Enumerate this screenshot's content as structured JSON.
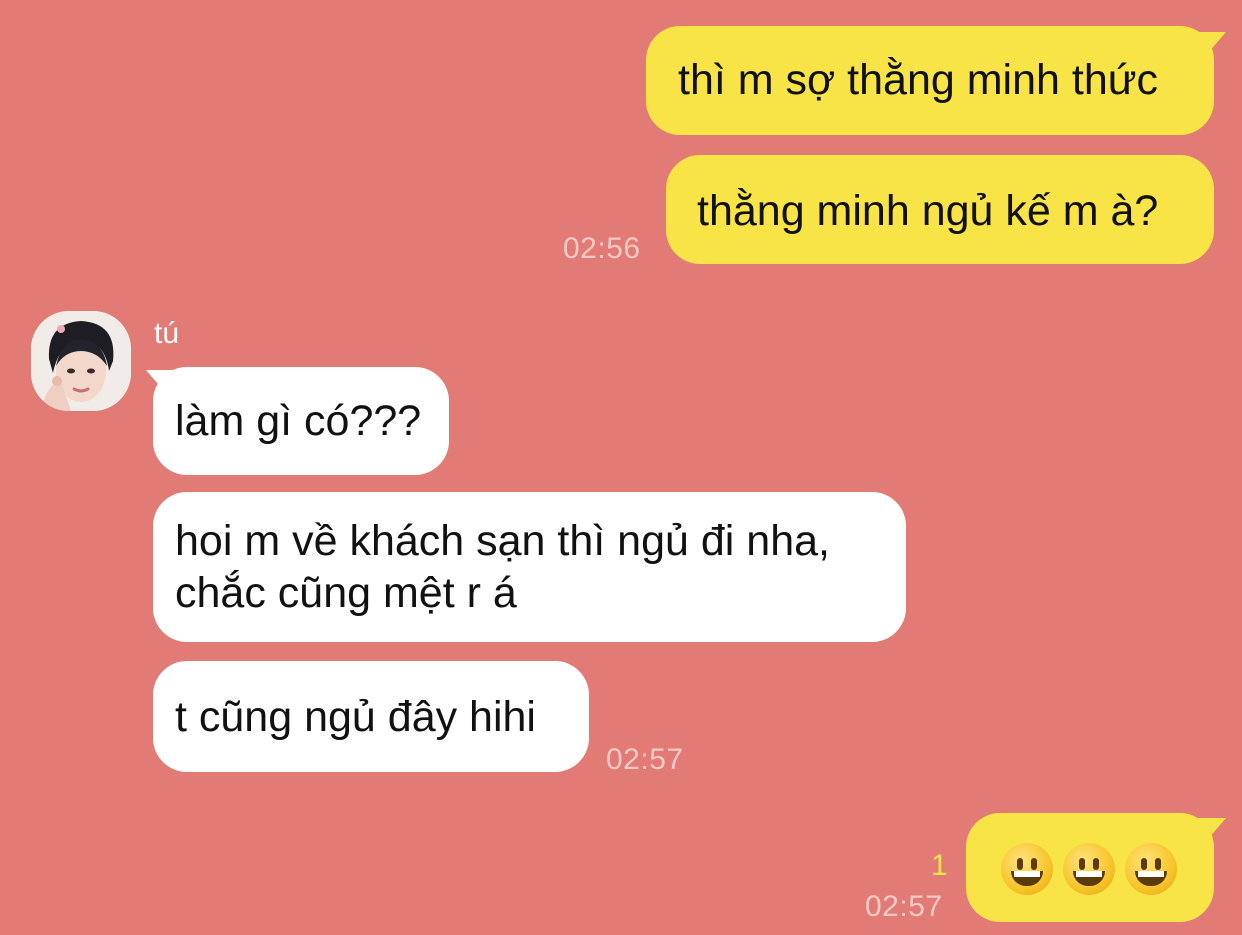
{
  "messages": {
    "out1": {
      "text": "thì m sợ thằng minh thức"
    },
    "out2": {
      "text": "thằng minh ngủ kế m à?",
      "time": "02:56"
    },
    "sender_name": "tú",
    "in1": {
      "text": "làm gì có???"
    },
    "in2": {
      "line1": "hoi m về khách sạn thì ngủ đi nha,",
      "line2": "chắc cũng mệt r á"
    },
    "in3": {
      "text": "t cũng ngủ đây hihi",
      "time": "02:57"
    },
    "out3": {
      "emoji": [
        "grinning-face-emoji",
        "grinning-face-emoji",
        "grinning-face-emoji"
      ],
      "unread_count": "1",
      "time": "02:57"
    }
  },
  "colors": {
    "background": "#e27b76",
    "outgoing_bubble": "#f8e447",
    "incoming_bubble": "#ffffff",
    "timestamp": "#f6c9c4",
    "unread": "#f8e447"
  }
}
